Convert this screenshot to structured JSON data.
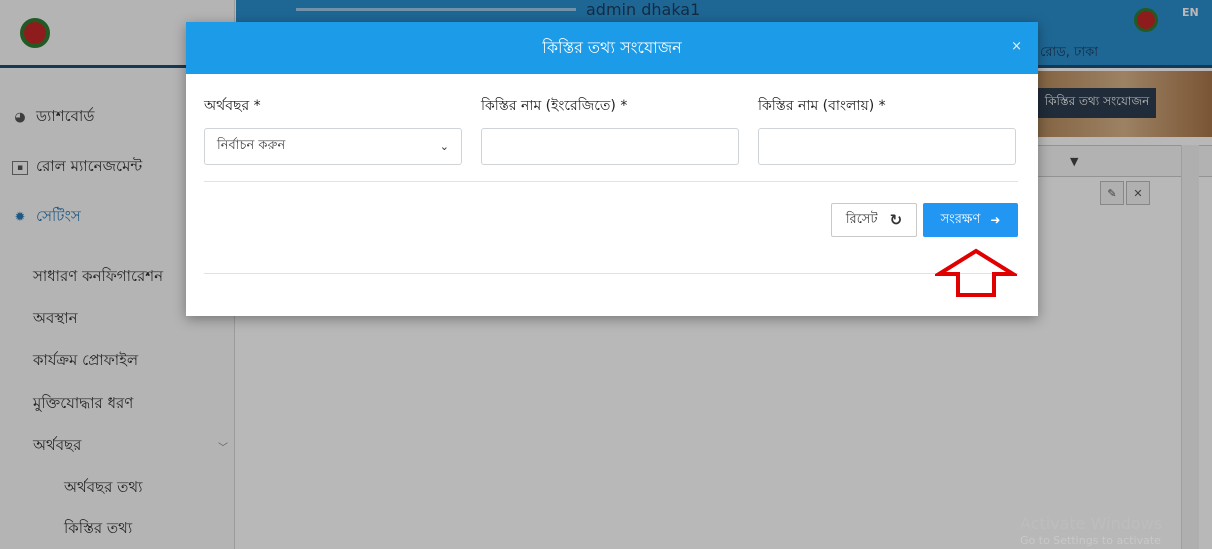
{
  "sidebar": {
    "items": [
      {
        "label": "ড্যাশবোর্ড",
        "icon": "palette-icon"
      },
      {
        "label": "রোল ম্যানেজমেন্ট",
        "icon": "user-card-icon"
      },
      {
        "label": "সেটিংস",
        "icon": "gear-icon"
      }
    ],
    "settings_children": [
      "সাধারণ কনফিগারেশন",
      "অবস্থান",
      "কার্যক্রম প্রোফাইল",
      "মুক্তিযোদ্ধার ধরণ",
      "অর্থবছর"
    ],
    "fiscal_children": [
      "অর্থবছর তথ্য",
      "কিস্তির তথ্য"
    ]
  },
  "topbar": {
    "user": "admin dhaka1",
    "address": "রোড, ঢাকা",
    "lang": "EN"
  },
  "page": {
    "add_button": "কিস্তির তথ্য সংযোজন"
  },
  "modal": {
    "title": "কিস্তির তথ্য সংযোজন",
    "close": "×",
    "fields": {
      "fiscal_year_label": "অর্থবছর *",
      "fiscal_year_value": "নির্বাচন করুন",
      "name_en_label": "কিস্তির নাম (ইংরেজিতে) *",
      "name_en_value": "",
      "name_bn_label": "কিস্তির নাম (বাংলায়) *",
      "name_bn_value": ""
    },
    "reset_label": "রিসেট",
    "save_label": "সংরক্ষণ"
  },
  "watermark": {
    "line1": "Activate Windows",
    "line2": "Go to Settings to activate Windows."
  },
  "colors": {
    "modal_header": "#1c9be8",
    "save_button": "#2196f3",
    "arrow": "#e00000"
  }
}
